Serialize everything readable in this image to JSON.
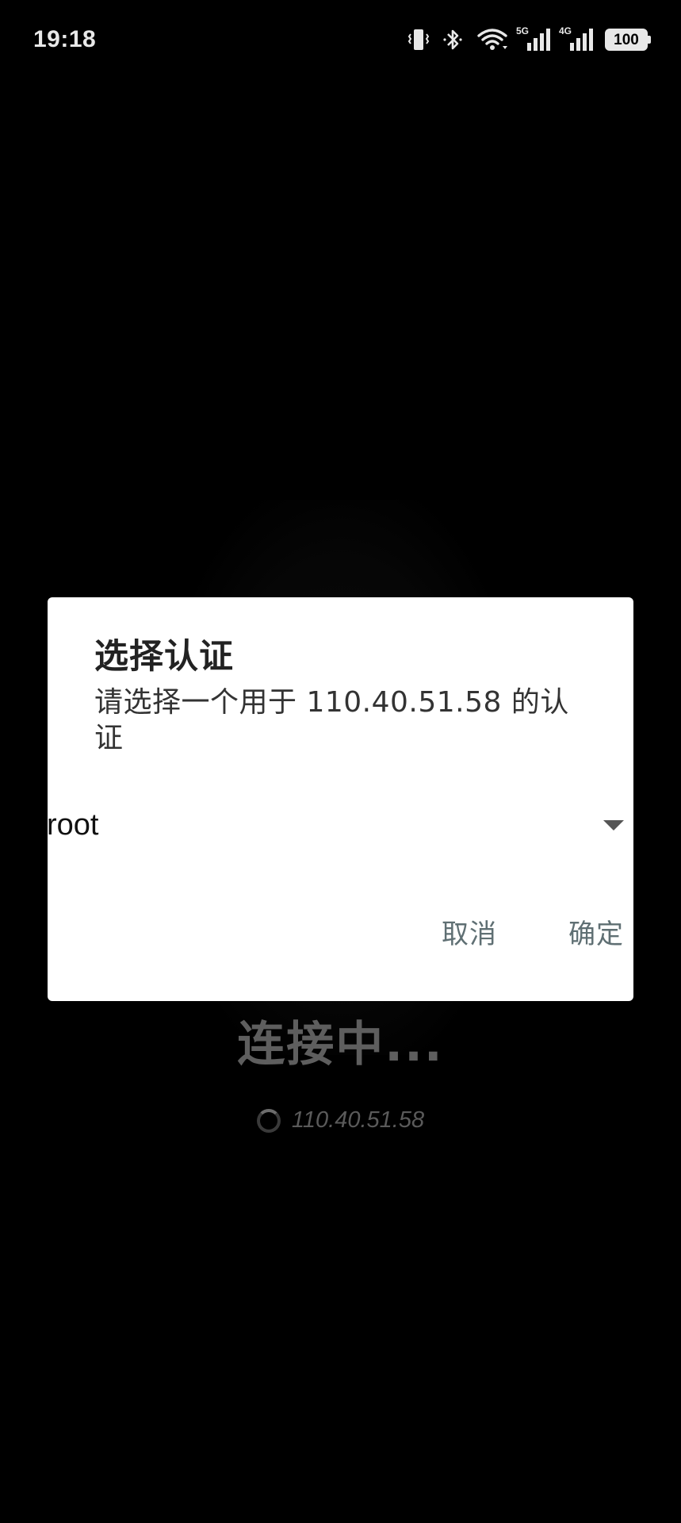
{
  "status_bar": {
    "time": "19:18",
    "network_5g_label": "5G",
    "network_4g_label": "4G",
    "battery_level": "100"
  },
  "background": {
    "connecting_title": "连接中...",
    "host": "110.40.51.58"
  },
  "dialog": {
    "title": "选择认证",
    "message": "请选择一个用于 110.40.51.58 的认证",
    "selected_option": "root",
    "cancel_label": "取消",
    "confirm_label": "确定"
  }
}
